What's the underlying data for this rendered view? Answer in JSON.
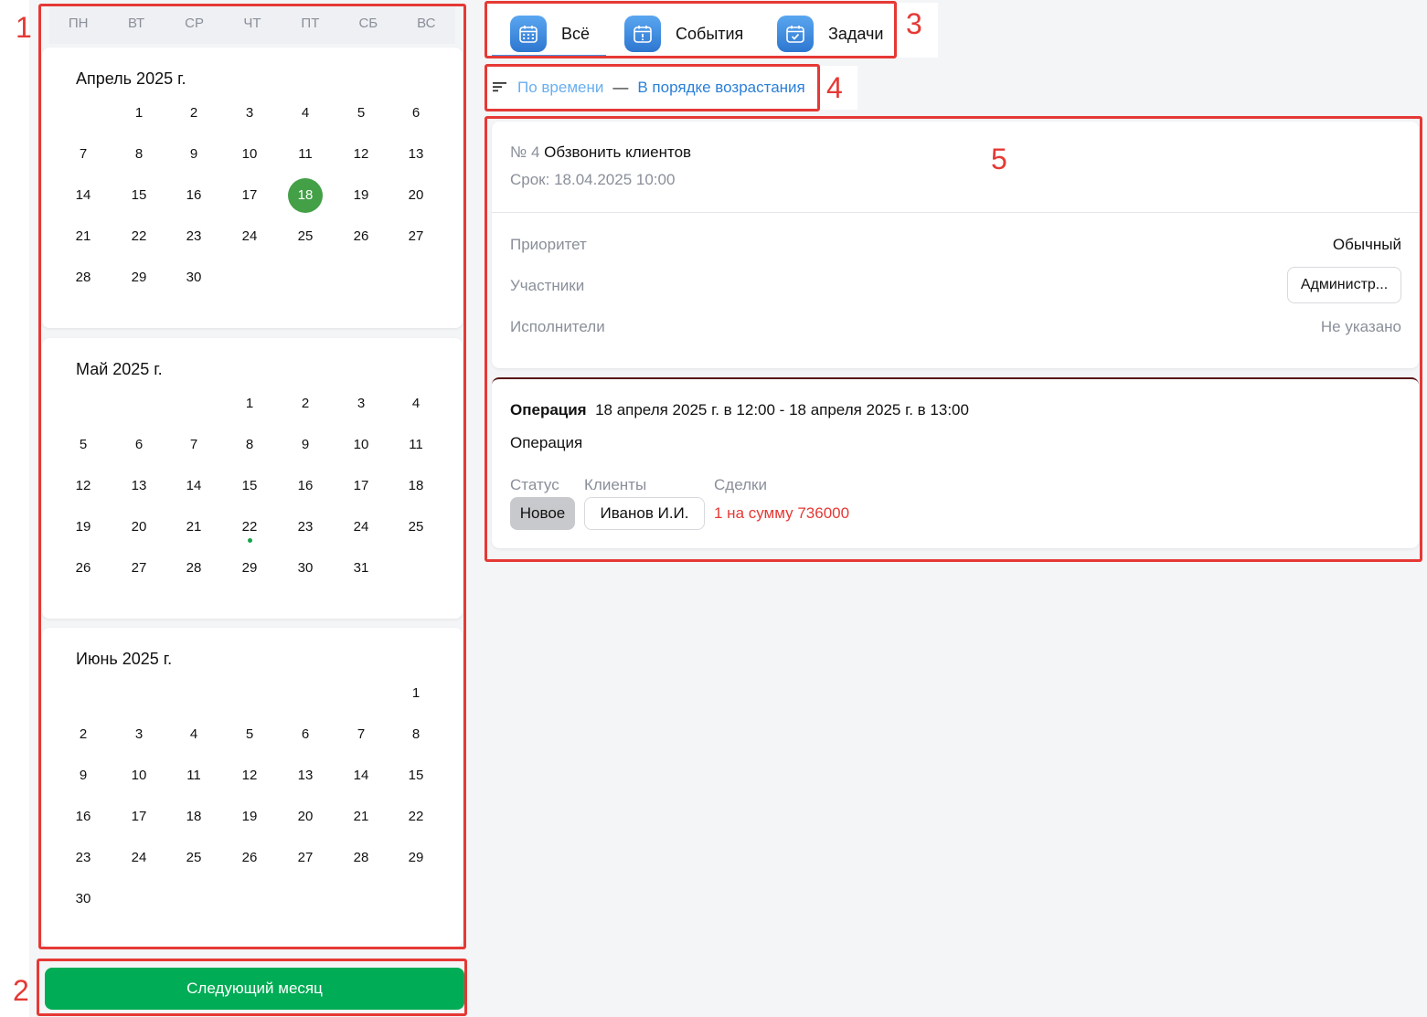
{
  "calendar": {
    "weekdays": [
      "ПН",
      "ВТ",
      "СР",
      "ЧТ",
      "ПТ",
      "СБ",
      "ВС"
    ],
    "months": [
      {
        "title": "Апрель 2025 г.",
        "first_weekday": 2,
        "days": 30,
        "selected_day": 18,
        "marked_days": []
      },
      {
        "title": "Май 2025 г.",
        "first_weekday": 4,
        "days": 31,
        "selected_day": null,
        "marked_days": [
          22
        ]
      },
      {
        "title": "Июнь 2025 г.",
        "first_weekday": 7,
        "days": 30,
        "selected_day": null,
        "marked_days": []
      }
    ],
    "next_button_label": "Следующий месяц",
    "accent_color": "#43a047"
  },
  "tabs": [
    {
      "label": "Всё",
      "icon": "calendar-grid-icon",
      "active": true
    },
    {
      "label": "События",
      "icon": "calendar-alert-icon",
      "active": false
    },
    {
      "label": "Задачи",
      "icon": "calendar-check-icon",
      "active": false
    }
  ],
  "sort": {
    "icon": "sort-icon",
    "criterion": "По времени",
    "separator": "—",
    "order": "В порядке возрастания"
  },
  "task": {
    "number": "№ 4",
    "title": "Обзвонить клиентов",
    "deadline": "Срок: 18.04.2025 10:00",
    "fields": [
      {
        "label": "Приоритет",
        "value": "Обычный"
      },
      {
        "label": "Участники",
        "value": "Администр..."
      },
      {
        "label": "Исполнители",
        "value": "Не указано"
      }
    ]
  },
  "event": {
    "type": "Операция",
    "period": "18 апреля 2025 г. в 12:00 - 18 апреля 2025 г. в 13:00",
    "description": "Операция",
    "status_label": "Статус",
    "status_value": "Новое",
    "clients_label": "Клиенты",
    "clients_value": "Иванов И.И.",
    "deals_label": "Сделки",
    "deals_value": "1 на сумму 736000",
    "deals_color": "#e53935"
  },
  "annotations": [
    "1",
    "2",
    "3",
    "4",
    "5"
  ]
}
